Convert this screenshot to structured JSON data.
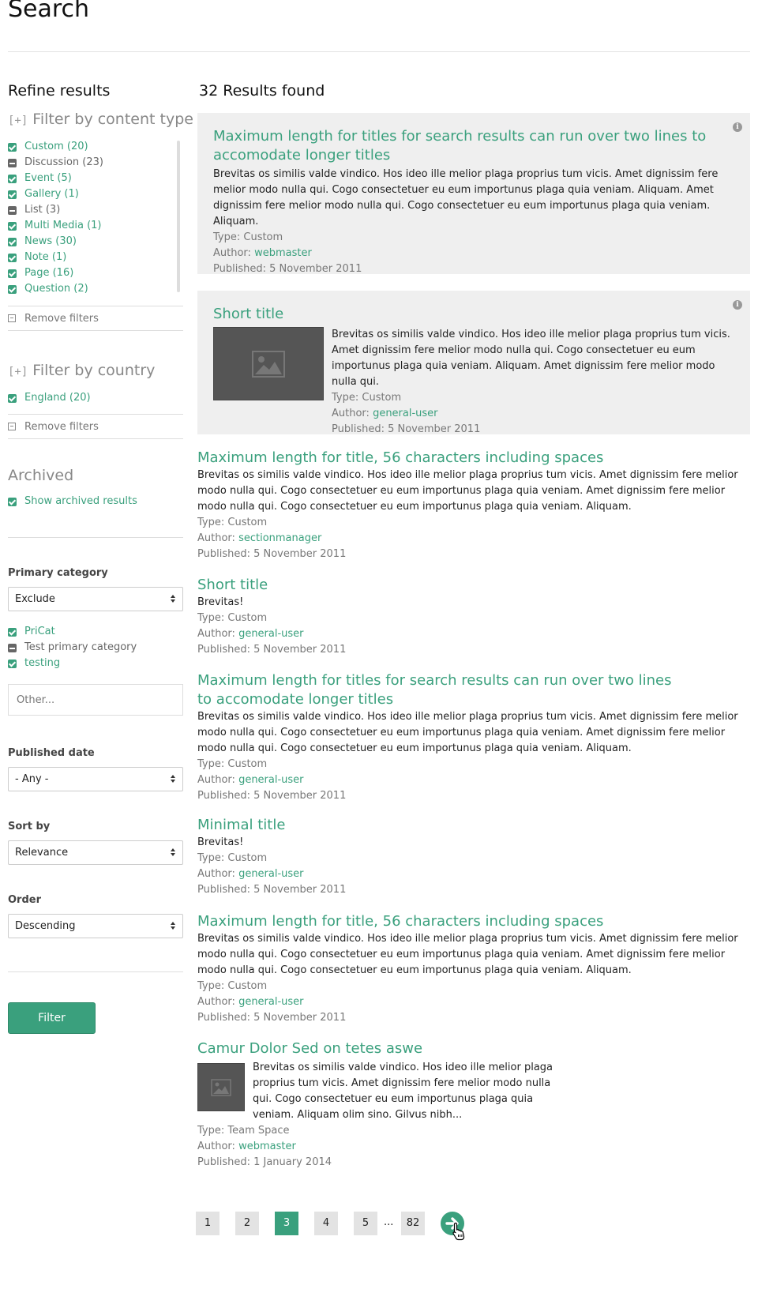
{
  "page": {
    "title": "Search"
  },
  "sidebar": {
    "heading": "Refine results",
    "content_type": {
      "toggle": "[+]",
      "title": "Filter by content type",
      "items": [
        {
          "label": "Custom (20)",
          "state": "checked"
        },
        {
          "label": "Discussion (23)",
          "state": "partial"
        },
        {
          "label": "Event (5)",
          "state": "checked"
        },
        {
          "label": "Gallery (1)",
          "state": "checked"
        },
        {
          "label": "List (3)",
          "state": "partial"
        },
        {
          "label": "Multi Media (1)",
          "state": "checked"
        },
        {
          "label": "News (30)",
          "state": "checked"
        },
        {
          "label": "Note (1)",
          "state": "checked"
        },
        {
          "label": "Page (16)",
          "state": "checked"
        },
        {
          "label": "Question (2)",
          "state": "checked"
        }
      ],
      "remove_label": "Remove filters"
    },
    "country": {
      "toggle": "[+]",
      "title": "Filter by country",
      "items": [
        {
          "label": "England (20)",
          "state": "checked"
        }
      ],
      "remove_label": "Remove filters"
    },
    "archived": {
      "title": "Archived",
      "checkbox_label": "Show archived results"
    },
    "primary_category": {
      "label": "Primary category",
      "select_value": "Exclude",
      "items": [
        {
          "label": "PriCat",
          "state": "checked"
        },
        {
          "label": "Test primary category",
          "state": "partial"
        },
        {
          "label": "testing",
          "state": "checked"
        }
      ],
      "other_placeholder": "Other..."
    },
    "published_date": {
      "label": "Published date",
      "select_value": "- Any -"
    },
    "sort_by": {
      "label": "Sort by",
      "select_value": "Relevance"
    },
    "order": {
      "label": "Order",
      "select_value": "Descending"
    },
    "filter_button": "Filter"
  },
  "results": {
    "count_label": "32 Results found",
    "items": [
      {
        "title": "Maximum length for titles for search results can run over two lines to accomodate longer titles",
        "desc": "Brevitas os similis valde vindico. Hos ideo ille melior plaga proprius tum vicis. Amet dignissim fere melior modo nulla qui. Cogo consectetuer eu eum importunus plaga quia veniam. Aliquam. Amet dignissim fere melior modo nulla qui. Cogo consectetuer eu eum importunus plaga quia veniam. Aliquam.",
        "type": "Type: Custom",
        "author_prefix": "Author: ",
        "author": "webmaster",
        "published": "Published: 5 November 2011"
      },
      {
        "title": "Short title",
        "desc": "Brevitas os similis valde vindico. Hos ideo ille melior plaga proprius tum vicis. Amet dignissim fere melior modo nulla qui. Cogo consectetuer eu eum importunus plaga quia veniam. Aliquam. Amet dignissim fere melior modo nulla qui.",
        "type": "Type: Custom",
        "author_prefix": "Author: ",
        "author": "general-user",
        "published": "Published: 5 November 2011"
      },
      {
        "title": "Maximum length for title, 56 characters including spaces",
        "desc": "Brevitas os similis valde vindico. Hos ideo ille melior plaga proprius tum vicis. Amet dignissim fere melior modo nulla qui. Cogo consectetuer eu eum importunus plaga quia veniam. Amet dignissim fere melior modo nulla qui. Cogo consectetuer eu eum importunus plaga quia veniam. Aliquam.",
        "type": "Type: Custom",
        "author_prefix": "Author: ",
        "author": "sectionmanager",
        "published": "Published: 5 November 2011"
      },
      {
        "title": "Short title",
        "desc": "Brevitas!",
        "type": "Type: Custom",
        "author_prefix": "Author: ",
        "author": "general-user",
        "published": "Published: 5 November 2011"
      },
      {
        "title": "Maximum length for titles for search results can run over two lines to accomodate longer titles",
        "desc": "Brevitas os similis valde vindico. Hos ideo ille melior plaga proprius tum vicis. Amet dignissim fere melior modo nulla qui. Cogo consectetuer eu eum importunus plaga quia veniam. Amet dignissim fere melior modo nulla qui. Cogo consectetuer eu eum importunus plaga quia veniam. Aliquam.",
        "type": "Type: Custom",
        "author_prefix": "Author: ",
        "author": "general-user",
        "published": "Published: 5 November 2011"
      },
      {
        "title": "Minimal title",
        "desc": "Brevitas!",
        "type": "Type: Custom",
        "author_prefix": "Author: ",
        "author": "general-user",
        "published": "Published: 5 November 2011"
      },
      {
        "title": "Maximum length for title, 56 characters including spaces",
        "desc": "Brevitas os similis valde vindico. Hos ideo ille melior plaga proprius tum vicis. Amet dignissim fere melior modo nulla qui. Cogo consectetuer eu eum importunus plaga quia veniam. Amet dignissim fere melior modo nulla qui. Cogo consectetuer eu eum importunus plaga quia veniam. Aliquam.",
        "type": "Type: Custom",
        "author_prefix": "Author: ",
        "author": "general-user",
        "published": "Published: 5 November 2011"
      },
      {
        "title": "Camur Dolor Sed on tetes aswe",
        "desc": "Brevitas os similis valde vindico. Hos ideo ille melior plaga proprius tum vicis. Amet dignissim fere melior modo nulla qui. Cogo consectetuer eu eum importunus plaga quia veniam. Aliquam olim sino. Gilvus nibh...",
        "type": "Type: Team Space",
        "author_prefix": "Author: ",
        "author": "webmaster",
        "published": "Published: 1 January 2014"
      }
    ]
  },
  "pagination": {
    "pages": [
      "1",
      "2",
      "3",
      "4",
      "5"
    ],
    "current": "3",
    "ellipsis": "...",
    "last": "82",
    "next_icon": "arrow-right-circle-icon"
  },
  "colors": {
    "accent": "#3aa07d",
    "featured_bg": "#efefef",
    "page_button_bg": "#e3e3e3"
  }
}
